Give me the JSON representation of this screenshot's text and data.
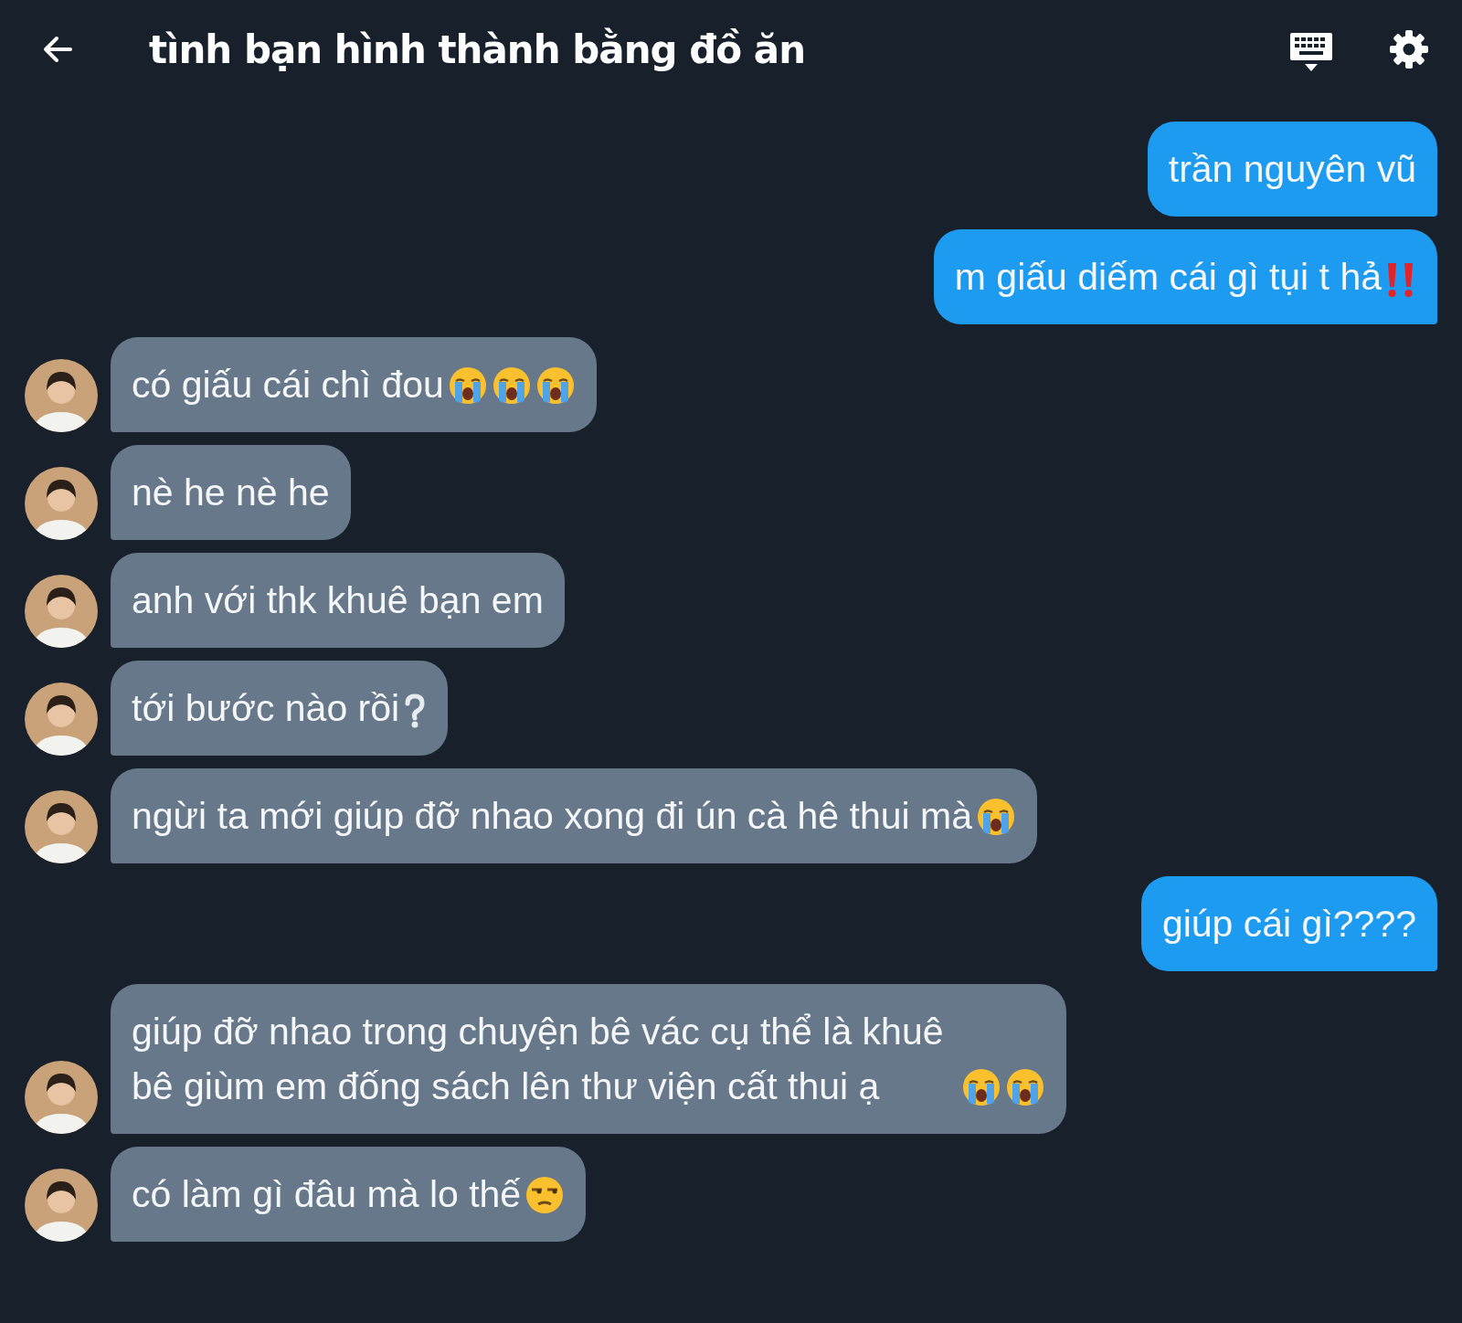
{
  "header": {
    "title": "tình bạn hình thành bằng đồ ăn"
  },
  "messages": [
    {
      "kind": "sent",
      "parts": [
        {
          "kind": "text",
          "text": "trần nguyên vũ"
        }
      ]
    },
    {
      "kind": "sent",
      "parts": [
        {
          "kind": "text",
          "text": "m giấu diếm cái gì tụi t hả"
        },
        {
          "kind": "bangbang"
        }
      ]
    },
    {
      "kind": "received",
      "avatar": {
        "kind": "picture"
      },
      "parts": [
        {
          "kind": "text",
          "text": "có giấu cái chì đou"
        },
        {
          "kind": "crying"
        },
        {
          "kind": "crying"
        },
        {
          "kind": "crying"
        }
      ]
    },
    {
      "kind": "received",
      "avatar": {
        "kind": "picture"
      },
      "parts": [
        {
          "kind": "text",
          "text": "nè he nè he"
        }
      ]
    },
    {
      "kind": "received",
      "avatar": {
        "kind": "picture"
      },
      "parts": [
        {
          "kind": "text",
          "text": "anh với thk khuê bạn em"
        }
      ]
    },
    {
      "kind": "received",
      "avatar": {
        "kind": "picture"
      },
      "parts": [
        {
          "kind": "text",
          "text": "tới bước nào rồi"
        },
        {
          "kind": "question"
        }
      ]
    },
    {
      "kind": "received",
      "avatar": {
        "kind": "picture"
      },
      "parts": [
        {
          "kind": "text",
          "text": "ngừi ta mới giúp đỡ nhao xong đi ún cà hê thui mà"
        },
        {
          "kind": "crying"
        }
      ]
    },
    {
      "kind": "sent",
      "parts": [
        {
          "kind": "text",
          "text": "giúp cái gì????"
        }
      ]
    },
    {
      "kind": "received",
      "avatar": {
        "kind": "picture"
      },
      "parts": [
        {
          "kind": "text",
          "text": "giúp đỡ nhao trong chuyện bê vác cụ thể là khuê bê giùm em đống sách lên thư viện cất thui ạ"
        },
        {
          "kind": "crying"
        },
        {
          "kind": "crying"
        }
      ]
    },
    {
      "kind": "received",
      "avatar": {
        "kind": "picture"
      },
      "parts": [
        {
          "kind": "text",
          "text": "có làm gì đâu mà lo thế"
        },
        {
          "kind": "unamused"
        }
      ]
    }
  ]
}
